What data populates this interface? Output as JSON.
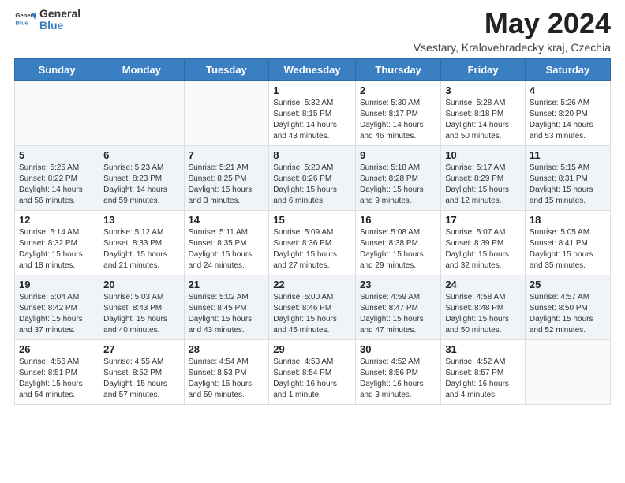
{
  "header": {
    "logo_line1": "General",
    "logo_line2": "Blue",
    "month_title": "May 2024",
    "location": "Vsestary, Kralovehradecky kraj, Czechia"
  },
  "weekdays": [
    "Sunday",
    "Monday",
    "Tuesday",
    "Wednesday",
    "Thursday",
    "Friday",
    "Saturday"
  ],
  "weeks": [
    [
      {
        "day": "",
        "info": ""
      },
      {
        "day": "",
        "info": ""
      },
      {
        "day": "",
        "info": ""
      },
      {
        "day": "1",
        "info": "Sunrise: 5:32 AM\nSunset: 8:15 PM\nDaylight: 14 hours\nand 43 minutes."
      },
      {
        "day": "2",
        "info": "Sunrise: 5:30 AM\nSunset: 8:17 PM\nDaylight: 14 hours\nand 46 minutes."
      },
      {
        "day": "3",
        "info": "Sunrise: 5:28 AM\nSunset: 8:18 PM\nDaylight: 14 hours\nand 50 minutes."
      },
      {
        "day": "4",
        "info": "Sunrise: 5:26 AM\nSunset: 8:20 PM\nDaylight: 14 hours\nand 53 minutes."
      }
    ],
    [
      {
        "day": "5",
        "info": "Sunrise: 5:25 AM\nSunset: 8:22 PM\nDaylight: 14 hours\nand 56 minutes."
      },
      {
        "day": "6",
        "info": "Sunrise: 5:23 AM\nSunset: 8:23 PM\nDaylight: 14 hours\nand 59 minutes."
      },
      {
        "day": "7",
        "info": "Sunrise: 5:21 AM\nSunset: 8:25 PM\nDaylight: 15 hours\nand 3 minutes."
      },
      {
        "day": "8",
        "info": "Sunrise: 5:20 AM\nSunset: 8:26 PM\nDaylight: 15 hours\nand 6 minutes."
      },
      {
        "day": "9",
        "info": "Sunrise: 5:18 AM\nSunset: 8:28 PM\nDaylight: 15 hours\nand 9 minutes."
      },
      {
        "day": "10",
        "info": "Sunrise: 5:17 AM\nSunset: 8:29 PM\nDaylight: 15 hours\nand 12 minutes."
      },
      {
        "day": "11",
        "info": "Sunrise: 5:15 AM\nSunset: 8:31 PM\nDaylight: 15 hours\nand 15 minutes."
      }
    ],
    [
      {
        "day": "12",
        "info": "Sunrise: 5:14 AM\nSunset: 8:32 PM\nDaylight: 15 hours\nand 18 minutes."
      },
      {
        "day": "13",
        "info": "Sunrise: 5:12 AM\nSunset: 8:33 PM\nDaylight: 15 hours\nand 21 minutes."
      },
      {
        "day": "14",
        "info": "Sunrise: 5:11 AM\nSunset: 8:35 PM\nDaylight: 15 hours\nand 24 minutes."
      },
      {
        "day": "15",
        "info": "Sunrise: 5:09 AM\nSunset: 8:36 PM\nDaylight: 15 hours\nand 27 minutes."
      },
      {
        "day": "16",
        "info": "Sunrise: 5:08 AM\nSunset: 8:38 PM\nDaylight: 15 hours\nand 29 minutes."
      },
      {
        "day": "17",
        "info": "Sunrise: 5:07 AM\nSunset: 8:39 PM\nDaylight: 15 hours\nand 32 minutes."
      },
      {
        "day": "18",
        "info": "Sunrise: 5:05 AM\nSunset: 8:41 PM\nDaylight: 15 hours\nand 35 minutes."
      }
    ],
    [
      {
        "day": "19",
        "info": "Sunrise: 5:04 AM\nSunset: 8:42 PM\nDaylight: 15 hours\nand 37 minutes."
      },
      {
        "day": "20",
        "info": "Sunrise: 5:03 AM\nSunset: 8:43 PM\nDaylight: 15 hours\nand 40 minutes."
      },
      {
        "day": "21",
        "info": "Sunrise: 5:02 AM\nSunset: 8:45 PM\nDaylight: 15 hours\nand 43 minutes."
      },
      {
        "day": "22",
        "info": "Sunrise: 5:00 AM\nSunset: 8:46 PM\nDaylight: 15 hours\nand 45 minutes."
      },
      {
        "day": "23",
        "info": "Sunrise: 4:59 AM\nSunset: 8:47 PM\nDaylight: 15 hours\nand 47 minutes."
      },
      {
        "day": "24",
        "info": "Sunrise: 4:58 AM\nSunset: 8:48 PM\nDaylight: 15 hours\nand 50 minutes."
      },
      {
        "day": "25",
        "info": "Sunrise: 4:57 AM\nSunset: 8:50 PM\nDaylight: 15 hours\nand 52 minutes."
      }
    ],
    [
      {
        "day": "26",
        "info": "Sunrise: 4:56 AM\nSunset: 8:51 PM\nDaylight: 15 hours\nand 54 minutes."
      },
      {
        "day": "27",
        "info": "Sunrise: 4:55 AM\nSunset: 8:52 PM\nDaylight: 15 hours\nand 57 minutes."
      },
      {
        "day": "28",
        "info": "Sunrise: 4:54 AM\nSunset: 8:53 PM\nDaylight: 15 hours\nand 59 minutes."
      },
      {
        "day": "29",
        "info": "Sunrise: 4:53 AM\nSunset: 8:54 PM\nDaylight: 16 hours\nand 1 minute."
      },
      {
        "day": "30",
        "info": "Sunrise: 4:52 AM\nSunset: 8:56 PM\nDaylight: 16 hours\nand 3 minutes."
      },
      {
        "day": "31",
        "info": "Sunrise: 4:52 AM\nSunset: 8:57 PM\nDaylight: 16 hours\nand 4 minutes."
      },
      {
        "day": "",
        "info": ""
      }
    ]
  ]
}
